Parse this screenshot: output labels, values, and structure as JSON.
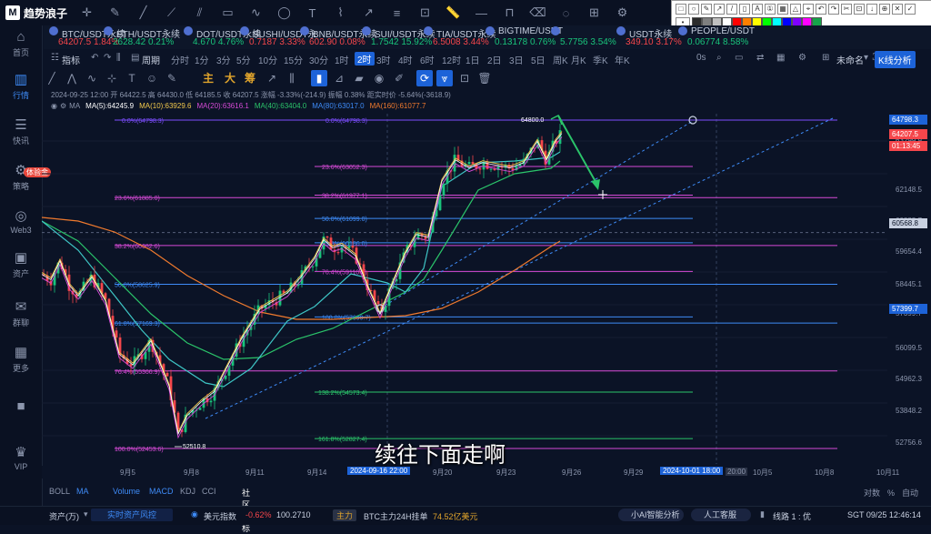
{
  "app": {
    "name": "趋势浪子"
  },
  "draw_tools": [
    "crosshair-icon",
    "pen-icon",
    "line-icon",
    "ray-icon",
    "channel-icon",
    "rect-icon",
    "curve-icon",
    "ellipse-icon",
    "text-icon",
    "brush-icon",
    "arrow-icon",
    "fib-icon",
    "measure-icon",
    "ruler-icon",
    "hline-icon",
    "magnet-icon",
    "eraser-icon",
    "hide-icon",
    "lock-icon"
  ],
  "palette_colors": [
    "#2c2c2c",
    "#7f7f7f",
    "#c0c0c0",
    "#ffffff",
    "#ff0000",
    "#ff7f00",
    "#ffff00",
    "#00ff00",
    "#00ffff",
    "#0000ff",
    "#8000ff",
    "#ff00ff",
    "#16a34a"
  ],
  "tickers": [
    {
      "name": "BTC/USDT永续",
      "price": "64207.5",
      "change": "1.84%",
      "dir": "dn"
    },
    {
      "name": "ETH/USDT永续",
      "price": "2628.42",
      "change": "0.21%",
      "dir": "up"
    },
    {
      "name": "DOT/USDT永续",
      "price": "4.670",
      "change": "4.76%",
      "dir": "up"
    },
    {
      "name": "SUSHI/USDT永",
      "price": "0.7187",
      "change": "3.33%",
      "dir": "dn"
    },
    {
      "name": "BNB/USDT永续",
      "price": "602.90",
      "change": "0.08%",
      "dir": "dn"
    },
    {
      "name": "SUI/USDT永续",
      "price": "1.7542",
      "change": "15.92%",
      "dir": "up"
    },
    {
      "name": "TIA/USDT永续",
      "price": "6.5008",
      "change": "3.44%",
      "dir": "dn"
    },
    {
      "name": "BIGTIME/USDT",
      "price": "0.13178",
      "change": "0.76%",
      "dir": "up"
    },
    {
      "name": "",
      "price": "5.7756",
      "change": "3.54%",
      "dir": "up"
    },
    {
      "name": "USDT永续",
      "price": "349.10",
      "change": "3.17%",
      "dir": "dn"
    },
    {
      "name": "PEOPLE/USDT",
      "price": "0.06774",
      "change": "8.58%",
      "dir": "up"
    }
  ],
  "sidebar": [
    {
      "label": "首页",
      "icon": "home-icon",
      "glyph": "⌂"
    },
    {
      "label": "行情",
      "icon": "market-icon",
      "glyph": "▥",
      "active": true
    },
    {
      "label": "快讯",
      "icon": "news-icon",
      "glyph": "☰"
    },
    {
      "label": "策略",
      "icon": "strategy-icon",
      "glyph": "⚙"
    },
    {
      "label": "Web3",
      "icon": "web3-icon",
      "glyph": "◎"
    },
    {
      "label": "资产",
      "icon": "wallet-icon",
      "glyph": "▣"
    },
    {
      "label": "群聊",
      "icon": "chat-icon",
      "glyph": "✉"
    },
    {
      "label": "更多",
      "icon": "more-icon",
      "glyph": "▦"
    },
    {
      "label": "",
      "icon": "app-icon",
      "glyph": "■"
    },
    {
      "label": "VIP",
      "icon": "vip-icon",
      "glyph": "♛"
    }
  ],
  "sidebar_badge": "体验金",
  "toolbar": {
    "indicators": "指标",
    "period_label": "周期",
    "timeframes": [
      "分时",
      "1分",
      "3分",
      "5分",
      "10分",
      "15分",
      "30分",
      "1时",
      "2时",
      "3时",
      "4时",
      "6时",
      "12时",
      "1日",
      "2日",
      "3日",
      "5日",
      "周K",
      "月K",
      "季K",
      "年K"
    ],
    "selected_timeframe": "2时",
    "countdown": "0s",
    "unnamed": "未命名",
    "kline_analysis": "K线分析"
  },
  "toolbar2": {
    "zh1": "主",
    "zh2": "大",
    "zh3": "筹"
  },
  "info": {
    "line1": "2024-09-25 12:00  开 64422.5  高 64430.0  低 64185.5  收 64207.5  涨幅 -3.33%(-214.9)  振幅 0.38%  距实时价 -5.64%(-3618.9)",
    "ma_label": "MA",
    "ma5": "MA(5):64245.9",
    "ma10": "MA(10):63929.6",
    "ma20": "MA(20):63616.1",
    "ma40": "MA(40):63404.0",
    "ma80": "MA(80):63017.0",
    "ma160": "MA(160):61077.7"
  },
  "fib_labels": {
    "left": [
      "0.0%(64798.3)",
      "23.6%(61885.0)",
      "38.2%(60082.6)",
      "50.0%(58625.9)",
      "61.8%(57169.3)",
      "76.4%(55366.9)",
      "100.0%(52453.6)"
    ],
    "mid": [
      "0.0%(64798.3)",
      "23.6%(63052.3)",
      "38.2%(61977.1)",
      "50.0%(61099.0)",
      "61.8%(60186.0)",
      "76.4%(59110.8)",
      "100.0%(57399.7)"
    ],
    "ext": [
      "138.2%(54573.4)",
      "161.8%(52827.4)"
    ],
    "high_mark": "64800.0",
    "low_mark": "52510.8"
  },
  "price_axis": {
    "ticks": [
      "63299.9",
      "62148.5",
      "60888.7",
      "59654.4",
      "58445.1",
      "57399.7",
      "56099.5",
      "54962.3",
      "53848.2",
      "52756.6"
    ],
    "last": "64207.5",
    "countdown": "01:13:45",
    "top": "64798.3",
    "crosshair": "60568.8",
    "low_line": "57399.7"
  },
  "time_axis": {
    "labels": [
      "9月5",
      "9月8",
      "9月11",
      "9月14",
      "9月20",
      "9月23",
      "9月26",
      "9月29",
      "10月5",
      "10月8",
      "10月11"
    ],
    "highlight_left": "2024-09-16 22:00",
    "highlight_right": "2024-10-01 18:00",
    "trail": "20:00"
  },
  "indicator_bar": [
    "BOLL",
    "MA",
    "Volume",
    "MACD",
    "KDJ",
    "CCI",
    "社区指标"
  ],
  "indicator_right": [
    "对数",
    "%",
    "自动"
  ],
  "status": {
    "asset": "资产(万)",
    "risk": "实时资产风控",
    "dollar_index_label": "美元指数",
    "dollar_index_change": "-0.62%",
    "dollar_index_value": "100.2710",
    "main_label": "主力",
    "main_text": "BTC主力24H挂单",
    "main_value": "74.52亿美元",
    "ai": "小AI智能分析",
    "service": "人工客服",
    "line": "线路 1 : 优",
    "time": "SGT 09/25 12:46:14"
  },
  "subtitle": "续往下面走啊"
}
